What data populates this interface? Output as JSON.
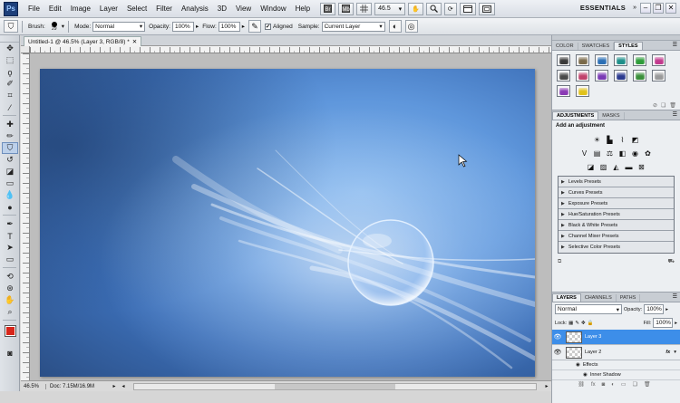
{
  "app": {
    "logo": "Ps",
    "menu": [
      "File",
      "Edit",
      "Image",
      "Layer",
      "Select",
      "Filter",
      "Analysis",
      "3D",
      "View",
      "Window",
      "Help"
    ],
    "zoom_select": "46.5",
    "workspace": "ESSENTIALS"
  },
  "options_bar": {
    "brush_label": "Brush:",
    "brush_size": "29",
    "mode_label": "Mode:",
    "mode_value": "Normal",
    "opacity_label": "Opacity:",
    "opacity_value": "100%",
    "flow_label": "Flow:",
    "flow_value": "100%",
    "aligned_label": "Aligned",
    "aligned_checked": true,
    "sample_label": "Sample:",
    "sample_value": "Current Layer"
  },
  "document": {
    "tab_title": "Untitled-1 @ 46.5% (Layer 3, RGB/8) *",
    "status_zoom": "46.5%",
    "status_doc": "Doc: 7.15M/16.9M"
  },
  "styles_panel": {
    "tabs": [
      "COLOR",
      "SWATCHES",
      "STYLES"
    ],
    "active_tab": "STYLES",
    "swatch_colors": [
      "#3a3a3a",
      "#7a6a4a",
      "#2b6fb5",
      "#1e8f8a",
      "#2d9c3a",
      "#c23a8e",
      "#4a4a4a",
      "#c0416b",
      "#7a3ab5",
      "#2b3a8f",
      "#3a8f3a",
      "#9a9a9a",
      "#8a3ab5",
      "#e0c21a"
    ]
  },
  "adjustments_panel": {
    "tabs": [
      "ADJUSTMENTS",
      "MASKS"
    ],
    "active_tab": "ADJUSTMENTS",
    "heading": "Add an adjustment",
    "presets": [
      "Levels Presets",
      "Curves Presets",
      "Exposure Presets",
      "Hue/Saturation Presets",
      "Black & White Presets",
      "Channel Mixer Presets",
      "Selective Color Presets"
    ]
  },
  "layers_panel": {
    "tabs": [
      "LAYERS",
      "CHANNELS",
      "PATHS"
    ],
    "active_tab": "LAYERS",
    "blend_mode": "Normal",
    "opacity_label": "Opacity:",
    "opacity_value": "100%",
    "lock_label": "Lock:",
    "fill_label": "Fill:",
    "fill_value": "100%",
    "layers": [
      {
        "name": "Layer 3",
        "selected": true
      },
      {
        "name": "Layer 2",
        "selected": false,
        "fx": "fx"
      }
    ],
    "effects_label": "Effects",
    "effect_items": [
      "Inner Shadow"
    ]
  }
}
